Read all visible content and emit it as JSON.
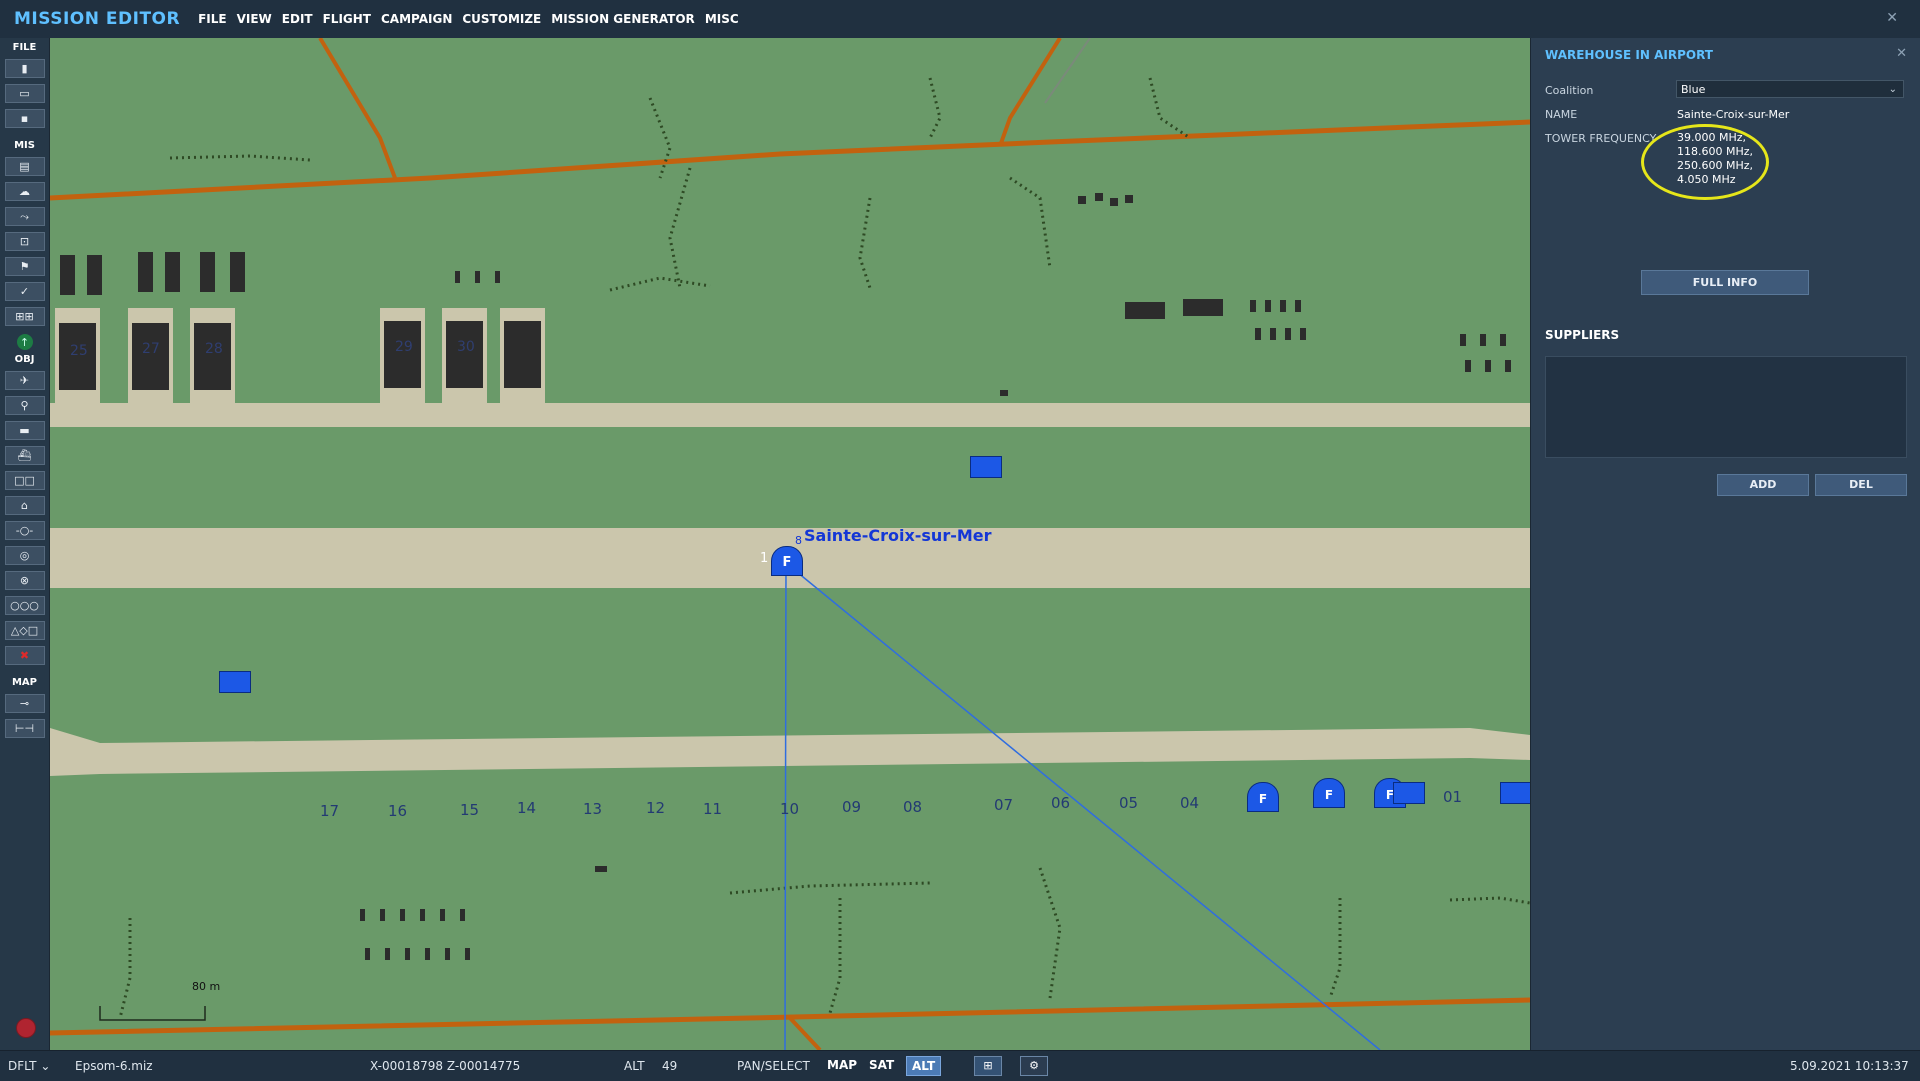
{
  "app": {
    "title": "MISSION EDITOR",
    "close_glyph": "✕"
  },
  "menu": [
    "FILE",
    "VIEW",
    "EDIT",
    "FLIGHT",
    "CAMPAIGN",
    "CUSTOMIZE",
    "MISSION GENERATOR",
    "MISC"
  ],
  "toolbar": {
    "sections": {
      "file": "FILE",
      "mis": "MIS",
      "obj": "OBJ",
      "map": "MAP"
    }
  },
  "map": {
    "airport_label": "Sainte-Croix-sur-Mer",
    "runway_end_label": "1",
    "runway_end_label_small": "8",
    "parking_marker": "F",
    "hangar_numbers": [
      "25",
      "27",
      "28",
      "29",
      "30"
    ],
    "parking_numbers": [
      "17",
      "16",
      "15",
      "14",
      "13",
      "12",
      "11",
      "10",
      "09",
      "08",
      "07",
      "06",
      "05",
      "04",
      "01"
    ],
    "scale_label": "80 m",
    "colors": {
      "grass": "#6a9a69",
      "tarmac": "#cbc6ac",
      "road": "#c2620f",
      "unit": "#1c58e6"
    }
  },
  "panel": {
    "title": "WAREHOUSE IN AIRPORT",
    "close_glyph": "✕",
    "coalition_label": "Coalition",
    "coalition_value": "Blue",
    "name_label": "NAME",
    "name_value": "Sainte-Croix-sur-Mer",
    "tower_label": "TOWER FREQUENCY",
    "tower_frequencies": [
      "39.000 MHz,",
      "118.600 MHz,",
      "250.600 MHz,",
      "4.050 MHz"
    ],
    "full_info_label": "FULL INFO",
    "suppliers_label": "SUPPLIERS",
    "add_label": "ADD",
    "del_label": "DEL"
  },
  "status": {
    "profile": "DFLT",
    "file": "Epsom-6.miz",
    "coords": "X-00018798 Z-00014775",
    "alt_label": "ALT",
    "alt_value": "49",
    "mode": "PAN/SELECT",
    "map_toggle": "MAP",
    "sat_toggle": "SAT",
    "alt_toggle": "ALT",
    "datetime": "5.09.2021 10:13:37"
  }
}
